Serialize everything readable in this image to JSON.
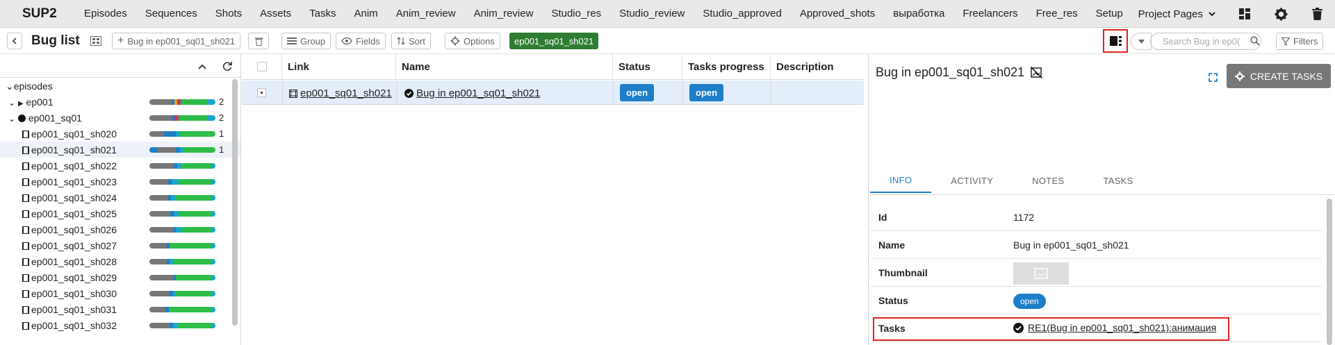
{
  "app": {
    "brand": "SUP2"
  },
  "nav": {
    "items": [
      "Episodes",
      "Sequences",
      "Shots",
      "Assets",
      "Tasks",
      "Anim",
      "Anim_review",
      "Anim_review",
      "Studio_res",
      "Studio_review",
      "Studio_approved",
      "Approved_shots",
      "выработка",
      "Freelancers",
      "Free_res",
      "Setup"
    ],
    "project_pages": "Project Pages"
  },
  "toolbar": {
    "title": "Bug list",
    "add_label": "Bug in ep001_sq01_sh021",
    "group": "Group",
    "fields": "Fields",
    "sort": "Sort",
    "options": "Options",
    "filter_tag": "ep001_sq01_sh021",
    "search_placeholder": "Search Bug in ep0(",
    "filters": "Filters"
  },
  "tree": {
    "root": "episodes",
    "rows": [
      {
        "label": "ep001",
        "count": "2",
        "bar": [
          [
            "#777",
            34
          ],
          [
            "#1e7ec8",
            4
          ],
          [
            "#e0a020",
            4
          ],
          [
            "#d0304c",
            4
          ],
          [
            "#777",
            4
          ],
          [
            "#2ebd48",
            38
          ],
          [
            "#1aa7c8",
            12
          ]
        ]
      },
      {
        "label": "ep001_sq01",
        "count": "2",
        "bar": [
          [
            "#777",
            34
          ],
          [
            "#1e7ec8",
            4
          ],
          [
            "#d0304c",
            4
          ],
          [
            "#777",
            4
          ],
          [
            "#2ebd48",
            42
          ],
          [
            "#1aa7c8",
            12
          ]
        ]
      },
      {
        "label": "ep001_sq01_sh020",
        "count": "1",
        "bar": [
          [
            "#777",
            22
          ],
          [
            "#1e7ec8",
            18
          ],
          [
            "#1aa7c8",
            6
          ],
          [
            "#2ebd48",
            54
          ]
        ]
      },
      {
        "label": "ep001_sq01_sh021",
        "count": "1",
        "bar": [
          [
            "#1e7ec8",
            12
          ],
          [
            "#777",
            28
          ],
          [
            "#1e7ec8",
            6
          ],
          [
            "#1aa7c8",
            6
          ],
          [
            "#2ebd48",
            48
          ]
        ]
      },
      {
        "label": "ep001_sq01_sh022",
        "count": "",
        "bar": [
          [
            "#777",
            36
          ],
          [
            "#1e7ec8",
            6
          ],
          [
            "#1aa7c8",
            6
          ],
          [
            "#2ebd48",
            46
          ],
          [
            "#1aa7c8",
            6
          ]
        ]
      },
      {
        "label": "ep001_sq01_sh023",
        "count": "",
        "bar": [
          [
            "#777",
            28
          ],
          [
            "#1e7ec8",
            6
          ],
          [
            "#1aa7c8",
            10
          ],
          [
            "#2ebd48",
            50
          ],
          [
            "#1aa7c8",
            6
          ]
        ]
      },
      {
        "label": "ep001_sq01_sh024",
        "count": "",
        "bar": [
          [
            "#777",
            28
          ],
          [
            "#1e7ec8",
            5
          ],
          [
            "#1aa7c8",
            6
          ],
          [
            "#2ebd48",
            55
          ],
          [
            "#1aa7c8",
            6
          ]
        ]
      },
      {
        "label": "ep001_sq01_sh025",
        "count": "",
        "bar": [
          [
            "#777",
            32
          ],
          [
            "#1e7ec8",
            6
          ],
          [
            "#1aa7c8",
            6
          ],
          [
            "#2ebd48",
            50
          ],
          [
            "#1aa7c8",
            6
          ]
        ]
      },
      {
        "label": "ep001_sq01_sh026",
        "count": "",
        "bar": [
          [
            "#777",
            36
          ],
          [
            "#1e7ec8",
            4
          ],
          [
            "#1aa7c8",
            8
          ],
          [
            "#2ebd48",
            46
          ],
          [
            "#1aa7c8",
            6
          ]
        ]
      },
      {
        "label": "ep001_sq01_sh027",
        "count": "",
        "bar": [
          [
            "#777",
            26
          ],
          [
            "#1e7ec8",
            5
          ],
          [
            "#2ebd48",
            63
          ],
          [
            "#1aa7c8",
            6
          ]
        ]
      },
      {
        "label": "ep001_sq01_sh028",
        "count": "",
        "bar": [
          [
            "#777",
            26
          ],
          [
            "#1e7ec8",
            5
          ],
          [
            "#1aa7c8",
            5
          ],
          [
            "#2ebd48",
            58
          ],
          [
            "#1aa7c8",
            6
          ]
        ]
      },
      {
        "label": "ep001_sq01_sh029",
        "count": "",
        "bar": [
          [
            "#777",
            36
          ],
          [
            "#1e7ec8",
            4
          ],
          [
            "#2ebd48",
            54
          ],
          [
            "#1aa7c8",
            6
          ]
        ]
      },
      {
        "label": "ep001_sq01_sh030",
        "count": "",
        "bar": [
          [
            "#777",
            30
          ],
          [
            "#1e7ec8",
            6
          ],
          [
            "#1aa7c8",
            4
          ],
          [
            "#2ebd48",
            54
          ],
          [
            "#1aa7c8",
            6
          ]
        ]
      },
      {
        "label": "ep001_sq01_sh031",
        "count": "",
        "bar": [
          [
            "#777",
            24
          ],
          [
            "#1e7ec8",
            6
          ],
          [
            "#2ebd48",
            64
          ],
          [
            "#1aa7c8",
            6
          ]
        ]
      },
      {
        "label": "ep001_sq01_sh032",
        "count": "",
        "bar": [
          [
            "#777",
            30
          ],
          [
            "#1e7ec8",
            6
          ],
          [
            "#1aa7c8",
            6
          ],
          [
            "#2ebd48",
            52
          ],
          [
            "#1aa7c8",
            6
          ]
        ]
      }
    ]
  },
  "table": {
    "columns": [
      "Link",
      "Name",
      "Status",
      "Tasks progress",
      "Description"
    ],
    "row": {
      "link": "ep001_sq01_sh021",
      "name": "Bug in ep001_sq01_sh021",
      "status": "open",
      "progress": "open"
    }
  },
  "panel": {
    "title": "Bug in ep001_sq01_sh021",
    "create_tasks": "CREATE TASKS",
    "tabs": [
      "INFO",
      "ACTIVITY",
      "NOTES",
      "TASKS"
    ],
    "info": {
      "id_label": "Id",
      "id_value": "1172",
      "name_label": "Name",
      "name_value": "Bug in ep001_sq01_sh021",
      "thumb_label": "Thumbnail",
      "status_label": "Status",
      "status_value": "open",
      "tasks_label": "Tasks",
      "tasks_value": "RE1(Bug in ep001_sq01_sh021):анимация"
    }
  },
  "colors": {
    "accent": "#1e7ec8",
    "tag_green": "#2e7d32",
    "highlight": "#e0201c"
  }
}
